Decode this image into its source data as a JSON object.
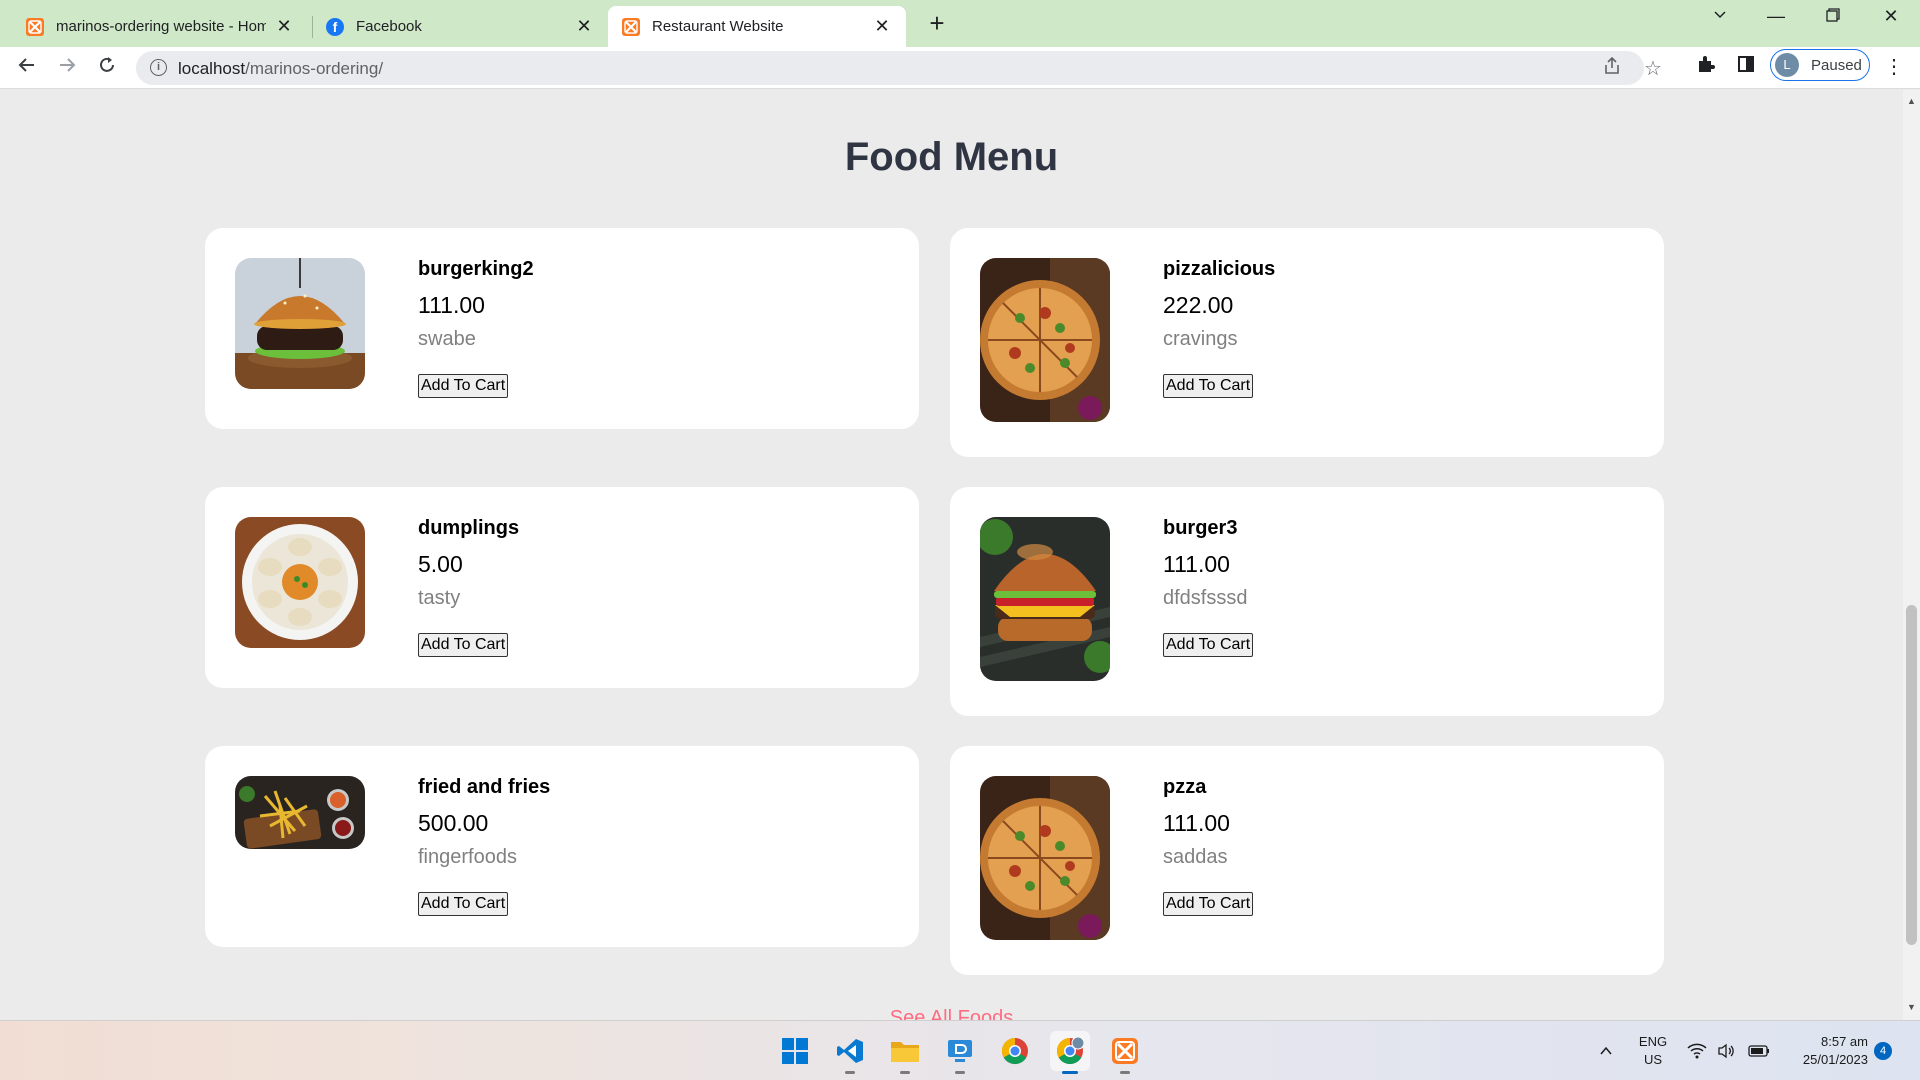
{
  "browser": {
    "tabs": [
      {
        "title": "marinos-ordering website - Hom",
        "icon": "xampp-icon",
        "active": false
      },
      {
        "title": "Facebook",
        "icon": "facebook-icon",
        "active": false
      },
      {
        "title": "Restaurant Website",
        "icon": "xampp-icon",
        "active": true
      }
    ],
    "url_host": "localhost",
    "url_path": "/marinos-ordering/",
    "profile_initial": "L",
    "profile_status": "Paused"
  },
  "page": {
    "title": "Food Menu",
    "see_all": "See All Foods",
    "foods": [
      {
        "name": "burgerking2",
        "price": "111.00",
        "description": "swabe",
        "button": "Add To Cart",
        "image": "burger-icon"
      },
      {
        "name": "pizzalicious",
        "price": "222.00",
        "description": "cravings",
        "button": "Add To Cart",
        "image": "pizza-icon"
      },
      {
        "name": "dumplings",
        "price": "5.00",
        "description": "tasty",
        "button": "Add To Cart",
        "image": "dumplings-icon"
      },
      {
        "name": "burger3",
        "price": "111.00",
        "description": "dfdsfsssd",
        "button": "Add To Cart",
        "image": "burger-icon"
      },
      {
        "name": "fried and fries",
        "price": "500.00",
        "description": "fingerfoods",
        "button": "Add To Cart",
        "image": "fries-icon"
      },
      {
        "name": "pzza",
        "price": "111.00",
        "description": "saddas",
        "button": "Add To Cart",
        "image": "pizza-icon"
      }
    ]
  },
  "taskbar": {
    "apps": [
      "windows-start-icon",
      "vscode-icon",
      "file-explorer-icon",
      "remote-desktop-icon",
      "chrome-icon",
      "chrome-profile-icon",
      "xampp-icon"
    ],
    "language_top": "ENG",
    "language_bottom": "US",
    "time": "8:57 am",
    "date": "25/01/2023",
    "notification_count": "4"
  },
  "colors": {
    "tabbar_bg": "#cfe8c8",
    "page_bg": "#ebebeb",
    "title_color": "#2f3542",
    "see_all_color": "#ff6b81",
    "xampp_orange": "#fb7a24"
  }
}
